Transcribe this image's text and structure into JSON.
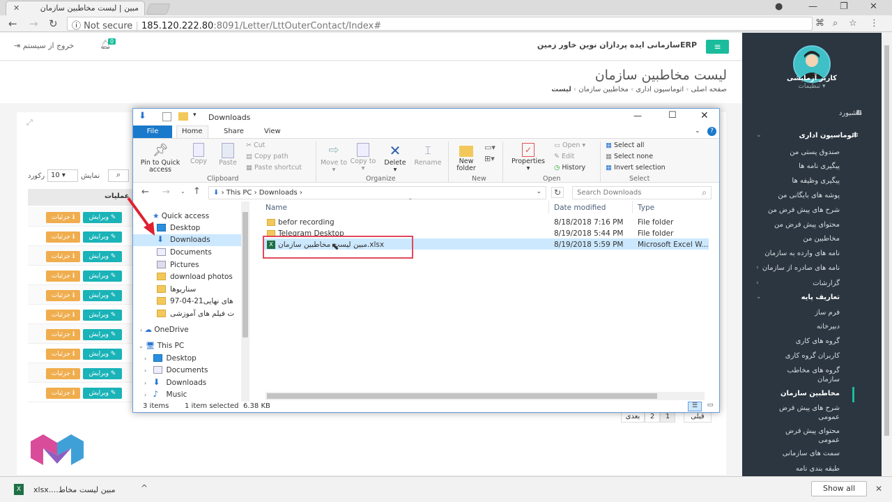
{
  "browser": {
    "tab_title": "مبین | لیست مخاطبین سازمان",
    "url_security": "Not secure",
    "url_host": "185.120.222.80",
    "url_path": ":8091/Letter/LttOuterContact/Index#"
  },
  "header": {
    "org_name": "ERPسازمانی ایده پردازان نوین خاور زمین",
    "logout": "خروج از سیستم",
    "notif_count": "0"
  },
  "page": {
    "title": "لیست مخاطبین سازمان",
    "breadcrumb": [
      "صفحه اصلی",
      "اتوماسیون اداری",
      "مخاطبین سازمان",
      "لیست"
    ],
    "show_label": "نمایش",
    "record_label": "رکورد",
    "page_size": "10",
    "operations_col": "عملیات",
    "btn_details": "جزئیات",
    "btn_edit": "ویرایش",
    "pager": {
      "prev": "قبلی",
      "p1": "1",
      "p2": "2",
      "next": "بعدی"
    }
  },
  "sidebar": {
    "user_name": "کاربر آزمایشی",
    "user_settings": "تنظیمات",
    "items": [
      {
        "label": "داشبورد"
      },
      {
        "label": "اتوماسیون اداری"
      },
      {
        "label": "صندوق پستی من"
      },
      {
        "label": "پیگیری نامه ها"
      },
      {
        "label": "پیگیری وظیفه ها"
      },
      {
        "label": "پوشه های بایگانی من"
      },
      {
        "label": "شرح های پیش فرض من"
      },
      {
        "label": "محتوای پیش فرض من"
      },
      {
        "label": "مخاطبین من"
      },
      {
        "label": "نامه های وارده به سازمان"
      },
      {
        "label": "نامه های صادره از سازمان"
      },
      {
        "label": "گزارشات"
      },
      {
        "label": "تعاریف پایه"
      },
      {
        "label": "فرم ساز"
      },
      {
        "label": "دبیرخانه"
      },
      {
        "label": "گروه های کاری"
      },
      {
        "label": "کاربران گروه کاری"
      },
      {
        "label": "گروه های مخاطب"
      },
      {
        "label": "سازمان"
      },
      {
        "label": "مخاطبین سازمان"
      },
      {
        "label": "شرح های پیش فرض"
      },
      {
        "label": "عمومی"
      },
      {
        "label": "محتوای پیش فرض"
      },
      {
        "label": "عمومی"
      },
      {
        "label": "سمت های سازمانی"
      },
      {
        "label": "طبقه بندی نامه"
      }
    ]
  },
  "explorer": {
    "title": "Downloads",
    "tabs": [
      "File",
      "Home",
      "Share",
      "View"
    ],
    "ribbon": {
      "pin": "Pin to Quick access",
      "copy": "Copy",
      "paste": "Paste",
      "cut": "Cut",
      "copy_path": "Copy path",
      "paste_shortcut": "Paste shortcut",
      "move_to": "Move to",
      "copy_to": "Copy to",
      "delete": "Delete",
      "rename": "Rename",
      "new_folder": "New folder",
      "properties": "Properties",
      "open": "Open",
      "edit": "Edit",
      "history": "History",
      "select_all": "Select all",
      "select_none": "Select none",
      "invert": "Invert selection",
      "g_clipboard": "Clipboard",
      "g_organize": "Organize",
      "g_new": "New",
      "g_open": "Open",
      "g_select": "Select"
    },
    "path": [
      "This PC",
      "Downloads"
    ],
    "search_placeholder": "Search Downloads",
    "nav": {
      "quick_access": "Quick access",
      "desktop": "Desktop",
      "downloads": "Downloads",
      "documents": "Documents",
      "pictures": "Pictures",
      "f1": "download photos",
      "f2": "سناریوها",
      "f3": "های نهایی21-04-97",
      "f4": "ت فیلم های آموزشی",
      "onedrive": "OneDrive",
      "thispc": "This PC",
      "pc_desktop": "Desktop",
      "pc_documents": "Documents",
      "pc_downloads": "Downloads",
      "pc_music": "Music"
    },
    "columns": {
      "name": "Name",
      "date": "Date modified",
      "type": "Type"
    },
    "files": [
      {
        "name": "befor recording",
        "date": "8/18/2018 7:16 PM",
        "type": "File folder"
      },
      {
        "name": "Telegram Desktop",
        "date": "8/19/2018 5:44 PM",
        "type": "File folder"
      },
      {
        "name": "مبین   لیست مخاطبین سازمان.xlsx",
        "date": "8/19/2018 5:59 PM",
        "type": "Microsoft Excel W..."
      }
    ],
    "status": {
      "items": "3 items",
      "selected": "1 item selected",
      "size": "6.38 KB"
    }
  },
  "downloads_bar": {
    "file": "مبین    لیست مخاط....xlsx",
    "show_all": "Show all"
  }
}
